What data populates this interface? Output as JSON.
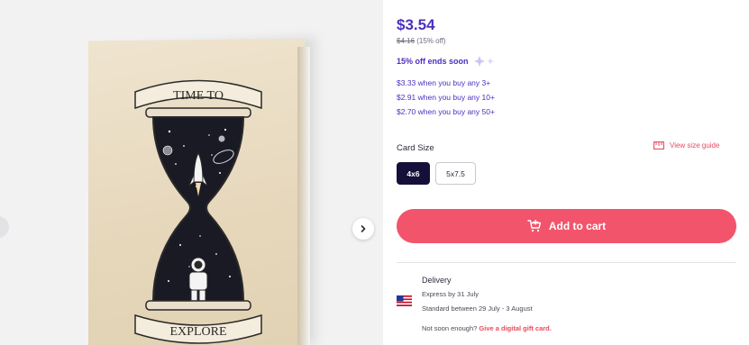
{
  "product": {
    "price": "$3.54",
    "old_price": "$4.16",
    "discount_note": "(15% off)",
    "offer_text": "15% off ends soon",
    "tiers": [
      "$3.33 when you buy any 3+",
      "$2.91 when you buy any 10+",
      "$2.70 when you buy any 50+"
    ]
  },
  "size": {
    "label": "Card Size",
    "guide_label": "View size guide",
    "options": [
      "4x6",
      "5x7.5"
    ],
    "selected": "4x6"
  },
  "cart": {
    "button_label": "Add to cart"
  },
  "delivery": {
    "title": "Delivery",
    "express": "Express by 31 July",
    "standard": "Standard between 29 July - 3 August",
    "not_soon": "Not soon enough?",
    "gift_link": "Give a digital gift card."
  },
  "artwork": {
    "banner_top": "TIME TO",
    "banner_bottom": "EXPLORE"
  },
  "icons": {
    "next": "chevron-right-icon",
    "prev": "chevron-left-icon",
    "size_guide": "ruler-icon",
    "cart": "cart-icon",
    "flag": "us-flag-icon",
    "sparkle": "sparkle-icon"
  },
  "colors": {
    "accent": "#4d2fbf",
    "cta": "#f2546c",
    "link": "#e84a5f",
    "selected": "#15103a"
  }
}
